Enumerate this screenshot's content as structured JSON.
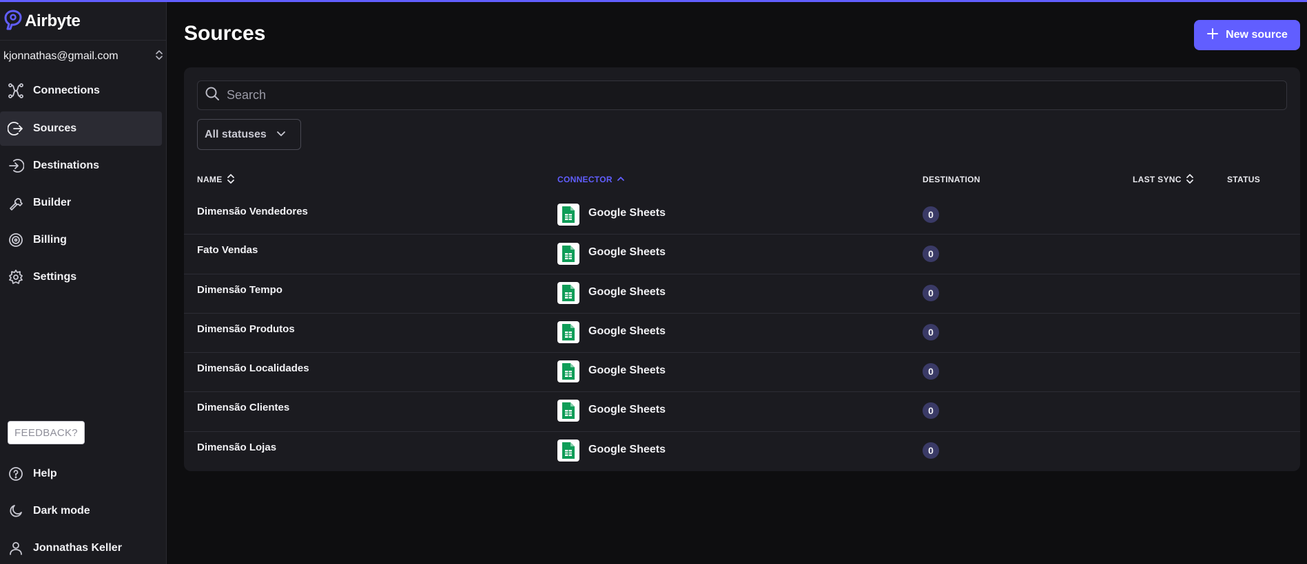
{
  "app": {
    "name": "Airbyte"
  },
  "workspace": {
    "email": "kjonnathas@gmail.com"
  },
  "nav": {
    "items": [
      {
        "label": "Connections",
        "icon": "connections-icon"
      },
      {
        "label": "Sources",
        "icon": "sources-icon",
        "active": true
      },
      {
        "label": "Destinations",
        "icon": "destinations-icon"
      },
      {
        "label": "Builder",
        "icon": "builder-icon"
      },
      {
        "label": "Billing",
        "icon": "billing-icon"
      },
      {
        "label": "Settings",
        "icon": "gear-icon"
      }
    ],
    "feedback": "FEEDBACK?",
    "bottom": [
      {
        "label": "Help",
        "icon": "help-icon"
      },
      {
        "label": "Dark mode",
        "icon": "moon-icon"
      },
      {
        "label": "Jonnathas Keller",
        "icon": "user-icon"
      }
    ]
  },
  "page": {
    "title": "Sources",
    "new_button": "New source",
    "search_placeholder": "Search",
    "status_filter": "All statuses"
  },
  "table": {
    "columns": [
      "NAME",
      "CONNECTOR",
      "DESTINATION",
      "LAST SYNC",
      "STATUS"
    ],
    "sorted_column": "CONNECTOR",
    "rows": [
      {
        "name": "Dimensão Vendedores",
        "connector": "Google Sheets",
        "destinations": "0"
      },
      {
        "name": "Fato Vendas",
        "connector": "Google Sheets",
        "destinations": "0"
      },
      {
        "name": "Dimensão Tempo",
        "connector": "Google Sheets",
        "destinations": "0"
      },
      {
        "name": "Dimensão Produtos",
        "connector": "Google Sheets",
        "destinations": "0"
      },
      {
        "name": "Dimensão Localidades",
        "connector": "Google Sheets",
        "destinations": "0"
      },
      {
        "name": "Dimensão Clientes",
        "connector": "Google Sheets",
        "destinations": "0"
      },
      {
        "name": "Dimensão Lojas",
        "connector": "Google Sheets",
        "destinations": "0"
      }
    ]
  },
  "colors": {
    "accent": "#615eff",
    "background": "#0e0e10",
    "sidebar": "#1b1b20",
    "badge": "#3a3a66",
    "sheets_green": "#0f9d58"
  }
}
